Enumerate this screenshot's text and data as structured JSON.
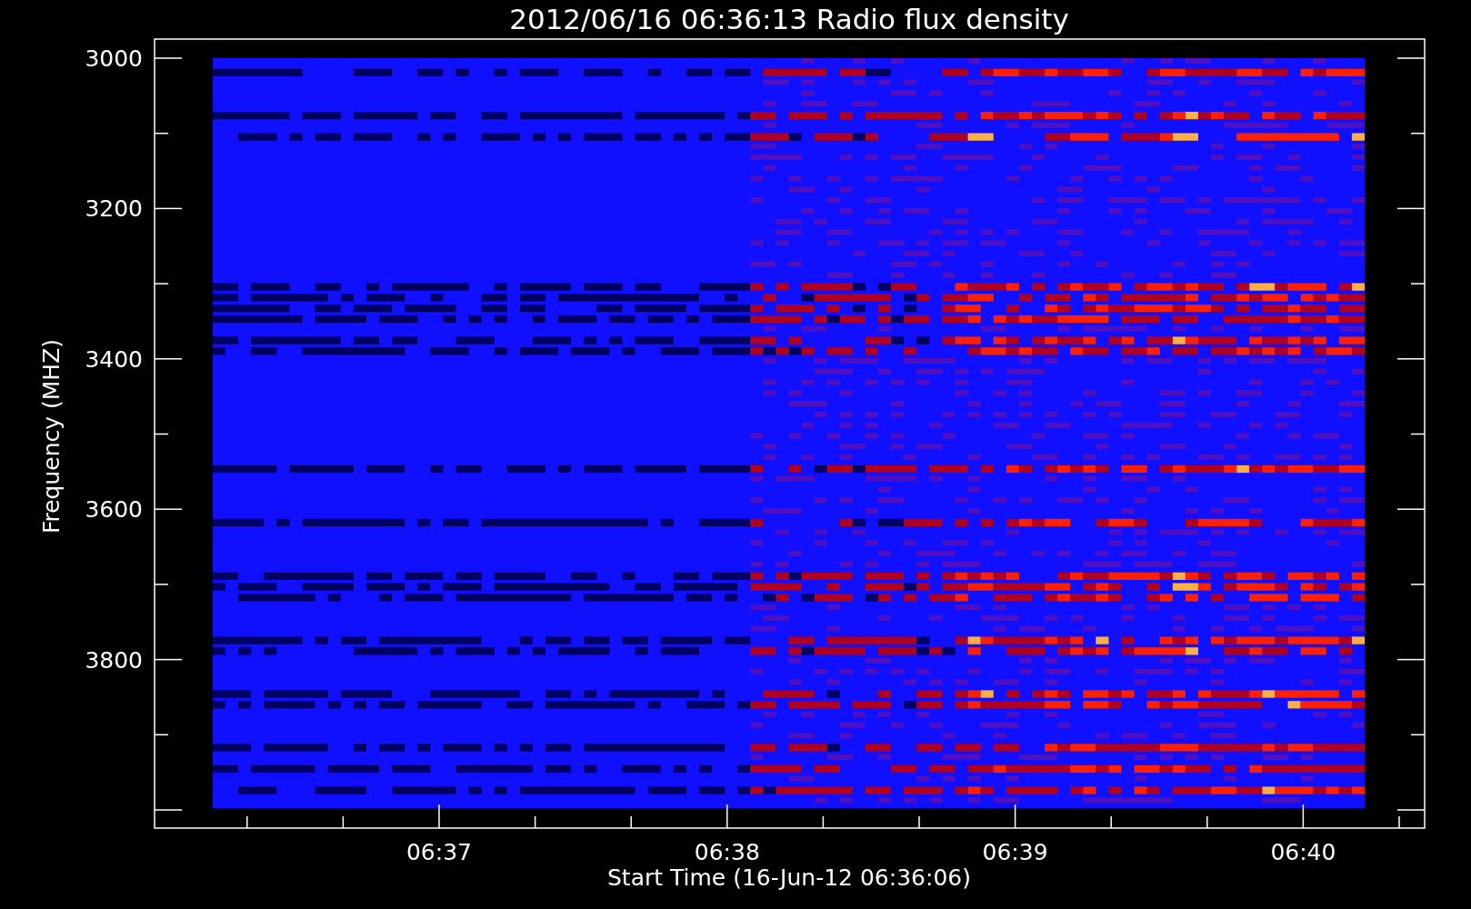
{
  "title": "2012/06/16 06:36:13 Radio flux density",
  "plot": {
    "ylabel": "Frequency (MHZ)",
    "xlabel": "Start Time (16-Jun-12 06:36:06)",
    "yticks": [
      "3000",
      "3200",
      "3400",
      "3600",
      "3800"
    ],
    "xticks": [
      "06:37",
      "06:38",
      "06:39",
      "06:40"
    ]
  }
}
